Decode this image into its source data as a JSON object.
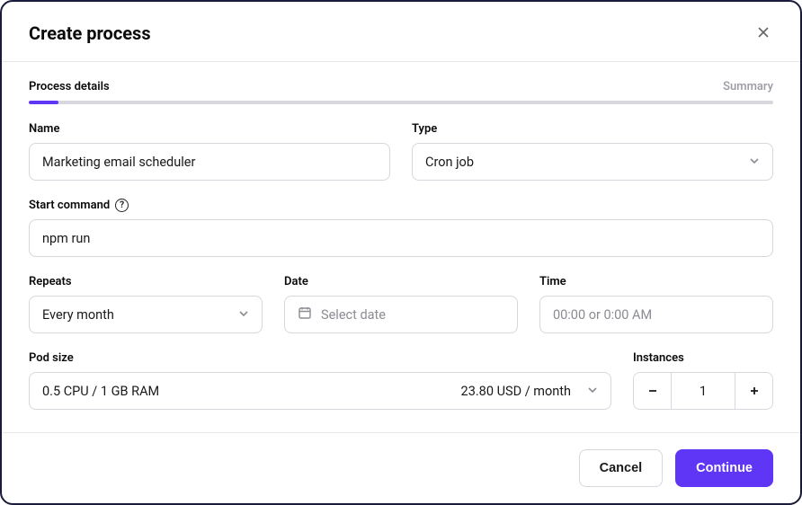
{
  "modal": {
    "title": "Create process"
  },
  "steps": {
    "current": "Process details",
    "next": "Summary",
    "progress_pct": 4
  },
  "fields": {
    "name": {
      "label": "Name",
      "value": "Marketing email scheduler"
    },
    "type": {
      "label": "Type",
      "value": "Cron job"
    },
    "start_command": {
      "label": "Start command",
      "value": "npm run"
    },
    "repeats": {
      "label": "Repeats",
      "value": "Every month"
    },
    "date": {
      "label": "Date",
      "placeholder": "Select date"
    },
    "time": {
      "label": "Time",
      "placeholder": "00:00 or 0:00 AM"
    },
    "pod_size": {
      "label": "Pod size",
      "value": "0.5 CPU / 1 GB RAM",
      "price": "23.80 USD / month"
    },
    "instances": {
      "label": "Instances",
      "value": "1"
    }
  },
  "footer": {
    "cancel": "Cancel",
    "continue": "Continue"
  }
}
